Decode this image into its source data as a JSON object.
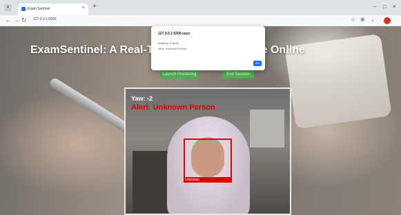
{
  "browser": {
    "tab_title": "Exam Sentinel",
    "tab_close": "×",
    "tab_menu": "▾",
    "new_tab": "+",
    "window_controls": [
      "–",
      "□",
      "×"
    ],
    "url": "127.0.0.1:5000",
    "icons": [
      "back-arrow",
      "forward-arrow",
      "reload",
      "star",
      "extensions",
      "download",
      "profile"
    ]
  },
  "page": {
    "title": "ExamSentinel: A Real-Ti... ...ystem for Secure Online",
    "buttons": {
      "launch": "Launch Proctoring",
      "end": "End Session"
    }
  },
  "alert": {
    "title": "127.0.0.1:5000 says",
    "line1": "Warning: 2 alerts",
    "line2": "Alert: Unknown Person",
    "ok": "OK"
  },
  "camera": {
    "yaw": "Yaw: -2",
    "alert": "Alert: Unknown Person",
    "face_label": "Unknown"
  },
  "colors": {
    "alert_red": "#e00000",
    "button_green": "#4caf50",
    "ok_blue": "#1a73e8"
  }
}
